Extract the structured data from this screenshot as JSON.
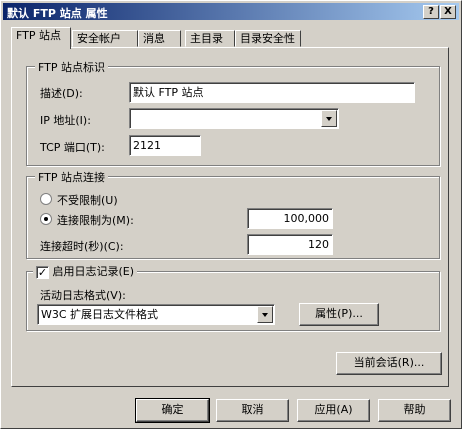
{
  "window": {
    "title": "默认 FTP 站点 属性",
    "help_btn": "?",
    "close_btn": "X"
  },
  "tabs": [
    {
      "label": "FTP 站点"
    },
    {
      "label": "安全帐户"
    },
    {
      "label": "消息"
    },
    {
      "label": "主目录"
    },
    {
      "label": "目录安全性"
    }
  ],
  "identity": {
    "legend": "FTP 站点标识",
    "desc_label": "描述(D):",
    "desc_value": "默认 FTP 站点",
    "ip_label": "IP 地址(I):",
    "ip_value": "",
    "port_label": "TCP 端口(T):",
    "port_value": "2121"
  },
  "connections": {
    "legend": "FTP 站点连接",
    "unlimited_label": "不受限制(U)",
    "limited_label": "连接限制为(M):",
    "limit_value": "100,000",
    "timeout_label": "连接超时(秒)(C):",
    "timeout_value": "120"
  },
  "logging": {
    "enable_label": "启用日志记录(E)",
    "enabled": true,
    "format_label": "活动日志格式(V):",
    "format_value": "W3C 扩展日志文件格式",
    "properties_btn": "属性(P)..."
  },
  "sessions_btn": "当前会话(R)...",
  "footer": {
    "ok": "确定",
    "cancel": "取消",
    "apply": "应用(A)",
    "help": "帮助"
  }
}
